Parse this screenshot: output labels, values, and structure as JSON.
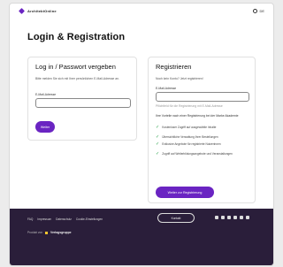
{
  "header": {
    "brand": "ArchitektOnline",
    "language": "DE"
  },
  "page_title": "Login & Registration",
  "login": {
    "title": "Log in / Passwort vergeben",
    "description": "Bitte melden Sie sich mit Ihrer persönlichen E-Mail-Adresse an.",
    "email_label": "E-Mail-Adresse",
    "email_value": "",
    "submit_label": "Weiter"
  },
  "register": {
    "title": "Registrieren",
    "intro": "Noch kein Konto? Jetzt registrieren!",
    "email_label": "E-Mail-Adresse",
    "email_value": "",
    "hint": "Pflichtfeld für die Registrierung mit E-Mail-Adresse",
    "benefits_title": "Ihre Vorteile nach einer Registrierung bei der Marke Akademie",
    "benefits": [
      "Kostenloser Zugriff auf ausgewählte Inhalte",
      "Übersichtliche Verwaltung Ihrer Bestellungen",
      "Exklusive Angebote für registrierte Nutzerinnen",
      "Zugriff auf Weiterbildungsangebote und Veranstaltungen"
    ],
    "submit_label": "Weiter zur Registrierung"
  },
  "footer": {
    "links": [
      "FAQ",
      "Impressum",
      "Datenschutz",
      "Cookie-Einstellungen"
    ],
    "pill_label": "Kontakt",
    "note_prefix": "Produkt von",
    "note_brand": "Verlagsgruppe",
    "social_icons": [
      "facebook-icon",
      "instagram-icon",
      "linkedin-icon",
      "xing-icon",
      "youtube-icon",
      "rss-icon"
    ]
  }
}
